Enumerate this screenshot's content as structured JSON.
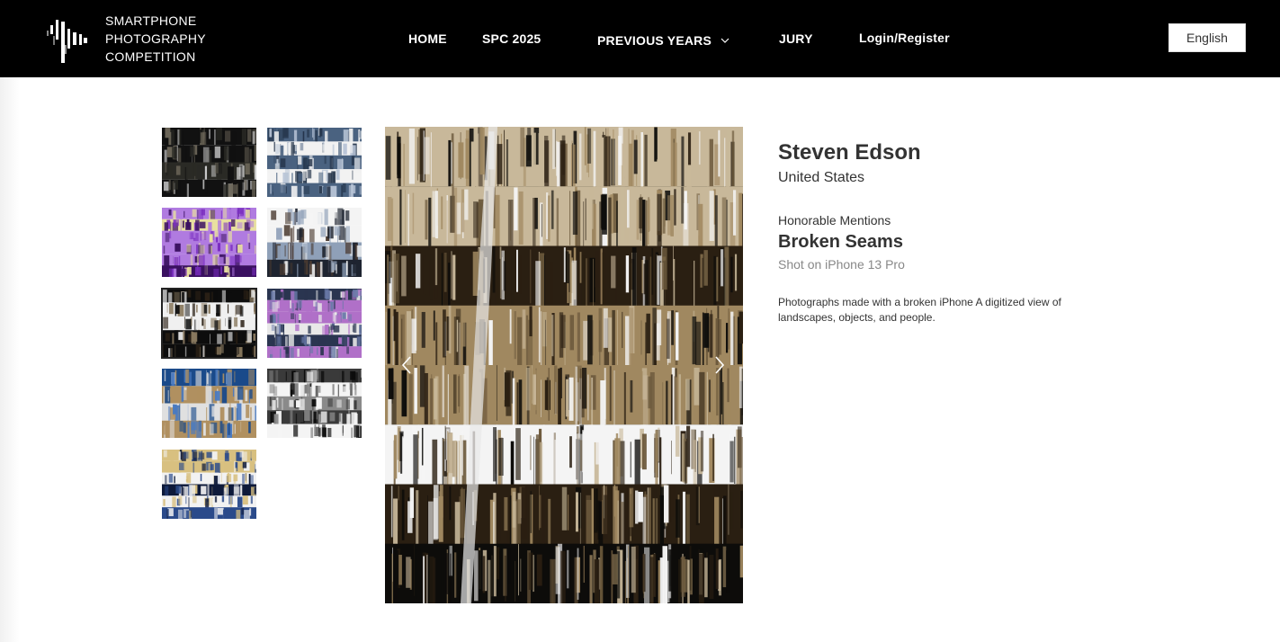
{
  "header": {
    "logo_lines": [
      "SMARTPHONE",
      "PHOTOGRAPHY",
      "COMPETITION"
    ],
    "nav": {
      "home": "HOME",
      "spc": "SPC 2025",
      "previous_years": "PREVIOUS YEARS",
      "jury": "JURY",
      "login": "Login/Register"
    },
    "language": "English"
  },
  "gallery": {
    "thumbnail_count": 9,
    "active_index": 4,
    "thumbnail_palettes": [
      [
        "#2a2a25",
        "#6b6558",
        "#cfcfcf",
        "#111111"
      ],
      [
        "#4a6280",
        "#b8c4d6",
        "#f2f2f2",
        "#24344a"
      ],
      [
        "#7a2ec0",
        "#b07be0",
        "#e8e0a0",
        "#3a1060"
      ],
      [
        "#1e2430",
        "#8fa0b8",
        "#f4f4f4",
        "#4a3a30"
      ],
      [
        "#2a2015",
        "#8a7a60",
        "#f0f0f0",
        "#0d0d0d"
      ],
      [
        "#2a3550",
        "#6a7aa8",
        "#b070c8",
        "#e8e8e8"
      ],
      [
        "#1a4a8a",
        "#4a7ac0",
        "#b09060",
        "#e0e0e0"
      ],
      [
        "#0a0a0a",
        "#3a3a3a",
        "#f4f4f4",
        "#8a8a8a"
      ],
      [
        "#0e1a3a",
        "#2a4a8a",
        "#d8c080",
        "#f2f2f2"
      ]
    ],
    "main_palette": [
      "#2a1f12",
      "#6d5a3d",
      "#c8b89a",
      "#f4f4f4",
      "#0d0c0a",
      "#a08860"
    ]
  },
  "entry": {
    "name": "Steven Edson",
    "country": "United States",
    "award": "Honorable Mentions",
    "title": "Broken Seams",
    "device": "Shot on iPhone 13 Pro",
    "description": "Photographs made with a broken iPhone A digitized view of landscapes, objects, and people."
  }
}
